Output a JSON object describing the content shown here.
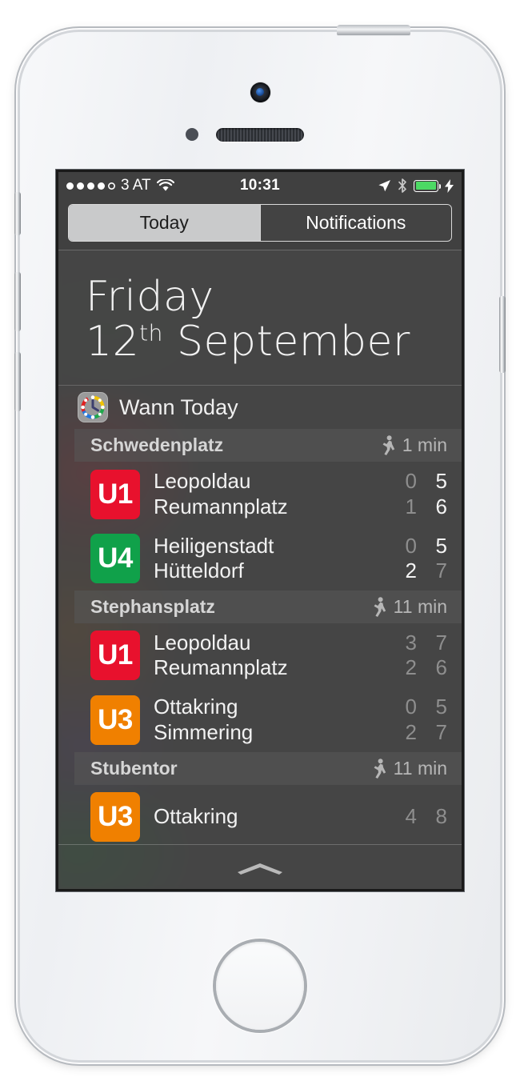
{
  "status_bar": {
    "signal_dots_filled": 4,
    "signal_dots_total": 5,
    "carrier": "3 AT",
    "wifi_icon": "wifi-icon",
    "time": "10:31",
    "location_icon": "location-arrow-icon",
    "bluetooth_icon": "bluetooth-icon",
    "battery_icon": "battery-icon",
    "battery_level_percent": 100,
    "battery_color": "#4cd964",
    "charging_icon": "lightning-bolt-icon"
  },
  "tabs": [
    {
      "label": "Today",
      "selected": true
    },
    {
      "label": "Notifications",
      "selected": false
    }
  ],
  "date_header": {
    "day_name": "Friday",
    "day_number": "12",
    "ordinal_suffix": "th",
    "month_name": "September"
  },
  "widget": {
    "app_icon": "wann-clock-icon",
    "title": "Wann Today",
    "walk_icon": "walking-person-icon",
    "walk_unit": "min",
    "stations": [
      {
        "name": "Schwedenplatz",
        "walk_time": "1 min",
        "lines": [
          {
            "line": "U1",
            "color": "#e8112d",
            "departures": [
              {
                "destination": "Leopoldau",
                "t1": "0",
                "t1_bright": false,
                "t2": "5",
                "t2_bright": true
              },
              {
                "destination": "Reumannplatz",
                "t1": "1",
                "t1_bright": false,
                "t2": "6",
                "t2_bright": true
              }
            ]
          },
          {
            "line": "U4",
            "color": "#10a14a",
            "departures": [
              {
                "destination": "Heiligenstadt",
                "t1": "0",
                "t1_bright": false,
                "t2": "5",
                "t2_bright": true
              },
              {
                "destination": "Hütteldorf",
                "t1": "2",
                "t1_bright": true,
                "t2": "7",
                "t2_bright": false
              }
            ]
          }
        ]
      },
      {
        "name": "Stephansplatz",
        "walk_time": "11 min",
        "lines": [
          {
            "line": "U1",
            "color": "#e8112d",
            "departures": [
              {
                "destination": "Leopoldau",
                "t1": "3",
                "t1_bright": false,
                "t2": "7",
                "t2_bright": false
              },
              {
                "destination": "Reumannplatz",
                "t1": "2",
                "t1_bright": false,
                "t2": "6",
                "t2_bright": false
              }
            ]
          },
          {
            "line": "U3",
            "color": "#f08000",
            "departures": [
              {
                "destination": "Ottakring",
                "t1": "0",
                "t1_bright": false,
                "t2": "5",
                "t2_bright": false
              },
              {
                "destination": "Simmering",
                "t1": "2",
                "t1_bright": false,
                "t2": "7",
                "t2_bright": false
              }
            ]
          }
        ]
      },
      {
        "name": "Stubentor",
        "walk_time": "11 min",
        "lines": [
          {
            "line": "U3",
            "color": "#f08000",
            "departures": [
              {
                "destination": "Ottakring",
                "t1": "4",
                "t1_bright": false,
                "t2": "8",
                "t2_bright": false
              }
            ]
          }
        ]
      }
    ]
  },
  "grabber": {
    "icon": "chevron-up-grabber-icon"
  }
}
